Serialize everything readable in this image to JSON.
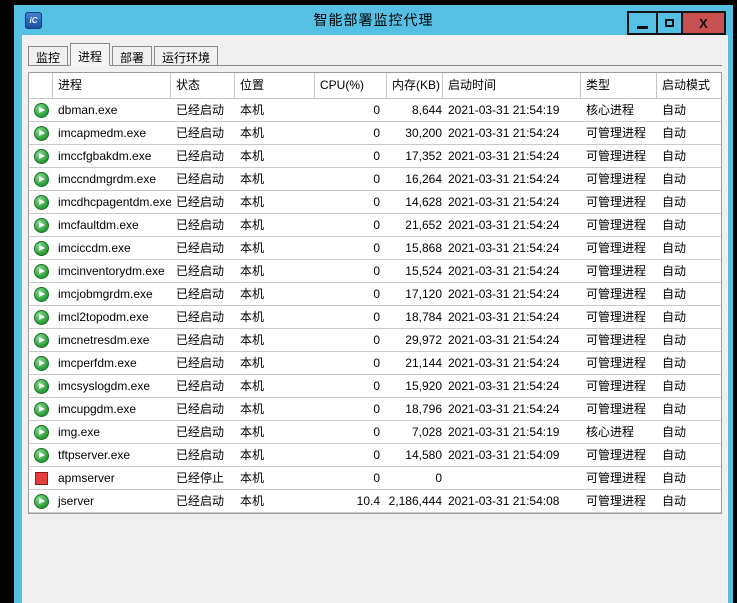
{
  "window": {
    "title": "智能部署监控代理",
    "app_icon_label": "iC",
    "controls": {
      "minimize": "minimize",
      "maximize": "maximize",
      "close_glyph": "X"
    }
  },
  "colors": {
    "titlebar_blue": "#55c0e4",
    "close_button_red": "#c75050",
    "content_gray": "#f0f0f0",
    "running_green": "#22982f",
    "stopped_red": "#e43d3d"
  },
  "tabs": [
    {
      "id": "monitor",
      "label": "监控",
      "active": false
    },
    {
      "id": "process",
      "label": "进程",
      "active": true
    },
    {
      "id": "deploy",
      "label": "部署",
      "active": false
    },
    {
      "id": "runtime-env",
      "label": "运行环境",
      "active": false
    }
  ],
  "table": {
    "columns": [
      "进程",
      "状态",
      "位置",
      "CPU(%)",
      "内存(KB)",
      "启动时间",
      "类型",
      "启动模式"
    ],
    "rows": [
      {
        "icon": "running",
        "process": "dbman.exe",
        "status": "已经启动",
        "location": "本机",
        "cpu": "0",
        "memory": "8,644",
        "start_time": "2021-03-31 21:54:19",
        "type": "核心进程",
        "mode": "自动"
      },
      {
        "icon": "running",
        "process": "imcapmedm.exe",
        "status": "已经启动",
        "location": "本机",
        "cpu": "0",
        "memory": "30,200",
        "start_time": "2021-03-31 21:54:24",
        "type": "可管理进程",
        "mode": "自动"
      },
      {
        "icon": "running",
        "process": "imccfgbakdm.exe",
        "status": "已经启动",
        "location": "本机",
        "cpu": "0",
        "memory": "17,352",
        "start_time": "2021-03-31 21:54:24",
        "type": "可管理进程",
        "mode": "自动"
      },
      {
        "icon": "running",
        "process": "imccndmgrdm.exe",
        "status": "已经启动",
        "location": "本机",
        "cpu": "0",
        "memory": "16,264",
        "start_time": "2021-03-31 21:54:24",
        "type": "可管理进程",
        "mode": "自动"
      },
      {
        "icon": "running",
        "process": "imcdhcpagentdm.exe",
        "status": "已经启动",
        "location": "本机",
        "cpu": "0",
        "memory": "14,628",
        "start_time": "2021-03-31 21:54:24",
        "type": "可管理进程",
        "mode": "自动"
      },
      {
        "icon": "running",
        "process": "imcfaultdm.exe",
        "status": "已经启动",
        "location": "本机",
        "cpu": "0",
        "memory": "21,652",
        "start_time": "2021-03-31 21:54:24",
        "type": "可管理进程",
        "mode": "自动"
      },
      {
        "icon": "running",
        "process": "imciccdm.exe",
        "status": "已经启动",
        "location": "本机",
        "cpu": "0",
        "memory": "15,868",
        "start_time": "2021-03-31 21:54:24",
        "type": "可管理进程",
        "mode": "自动"
      },
      {
        "icon": "running",
        "process": "imcinventorydm.exe",
        "status": "已经启动",
        "location": "本机",
        "cpu": "0",
        "memory": "15,524",
        "start_time": "2021-03-31 21:54:24",
        "type": "可管理进程",
        "mode": "自动"
      },
      {
        "icon": "running",
        "process": "imcjobmgrdm.exe",
        "status": "已经启动",
        "location": "本机",
        "cpu": "0",
        "memory": "17,120",
        "start_time": "2021-03-31 21:54:24",
        "type": "可管理进程",
        "mode": "自动"
      },
      {
        "icon": "running",
        "process": "imcl2topodm.exe",
        "status": "已经启动",
        "location": "本机",
        "cpu": "0",
        "memory": "18,784",
        "start_time": "2021-03-31 21:54:24",
        "type": "可管理进程",
        "mode": "自动"
      },
      {
        "icon": "running",
        "process": "imcnetresdm.exe",
        "status": "已经启动",
        "location": "本机",
        "cpu": "0",
        "memory": "29,972",
        "start_time": "2021-03-31 21:54:24",
        "type": "可管理进程",
        "mode": "自动"
      },
      {
        "icon": "running",
        "process": "imcperfdm.exe",
        "status": "已经启动",
        "location": "本机",
        "cpu": "0",
        "memory": "21,144",
        "start_time": "2021-03-31 21:54:24",
        "type": "可管理进程",
        "mode": "自动"
      },
      {
        "icon": "running",
        "process": "imcsyslogdm.exe",
        "status": "已经启动",
        "location": "本机",
        "cpu": "0",
        "memory": "15,920",
        "start_time": "2021-03-31 21:54:24",
        "type": "可管理进程",
        "mode": "自动"
      },
      {
        "icon": "running",
        "process": "imcupgdm.exe",
        "status": "已经启动",
        "location": "本机",
        "cpu": "0",
        "memory": "18,796",
        "start_time": "2021-03-31 21:54:24",
        "type": "可管理进程",
        "mode": "自动"
      },
      {
        "icon": "running",
        "process": "img.exe",
        "status": "已经启动",
        "location": "本机",
        "cpu": "0",
        "memory": "7,028",
        "start_time": "2021-03-31 21:54:19",
        "type": "核心进程",
        "mode": "自动"
      },
      {
        "icon": "running",
        "process": "tftpserver.exe",
        "status": "已经启动",
        "location": "本机",
        "cpu": "0",
        "memory": "14,580",
        "start_time": "2021-03-31 21:54:09",
        "type": "可管理进程",
        "mode": "自动"
      },
      {
        "icon": "stopped",
        "process": "apmserver",
        "status": "已经停止",
        "location": "本机",
        "cpu": "0",
        "memory": "0",
        "start_time": "",
        "type": "可管理进程",
        "mode": "自动"
      },
      {
        "icon": "running",
        "process": "jserver",
        "status": "已经启动",
        "location": "本机",
        "cpu": "10.4",
        "memory": "2,186,444",
        "start_time": "2021-03-31 21:54:08",
        "type": "可管理进程",
        "mode": "自动"
      }
    ]
  }
}
